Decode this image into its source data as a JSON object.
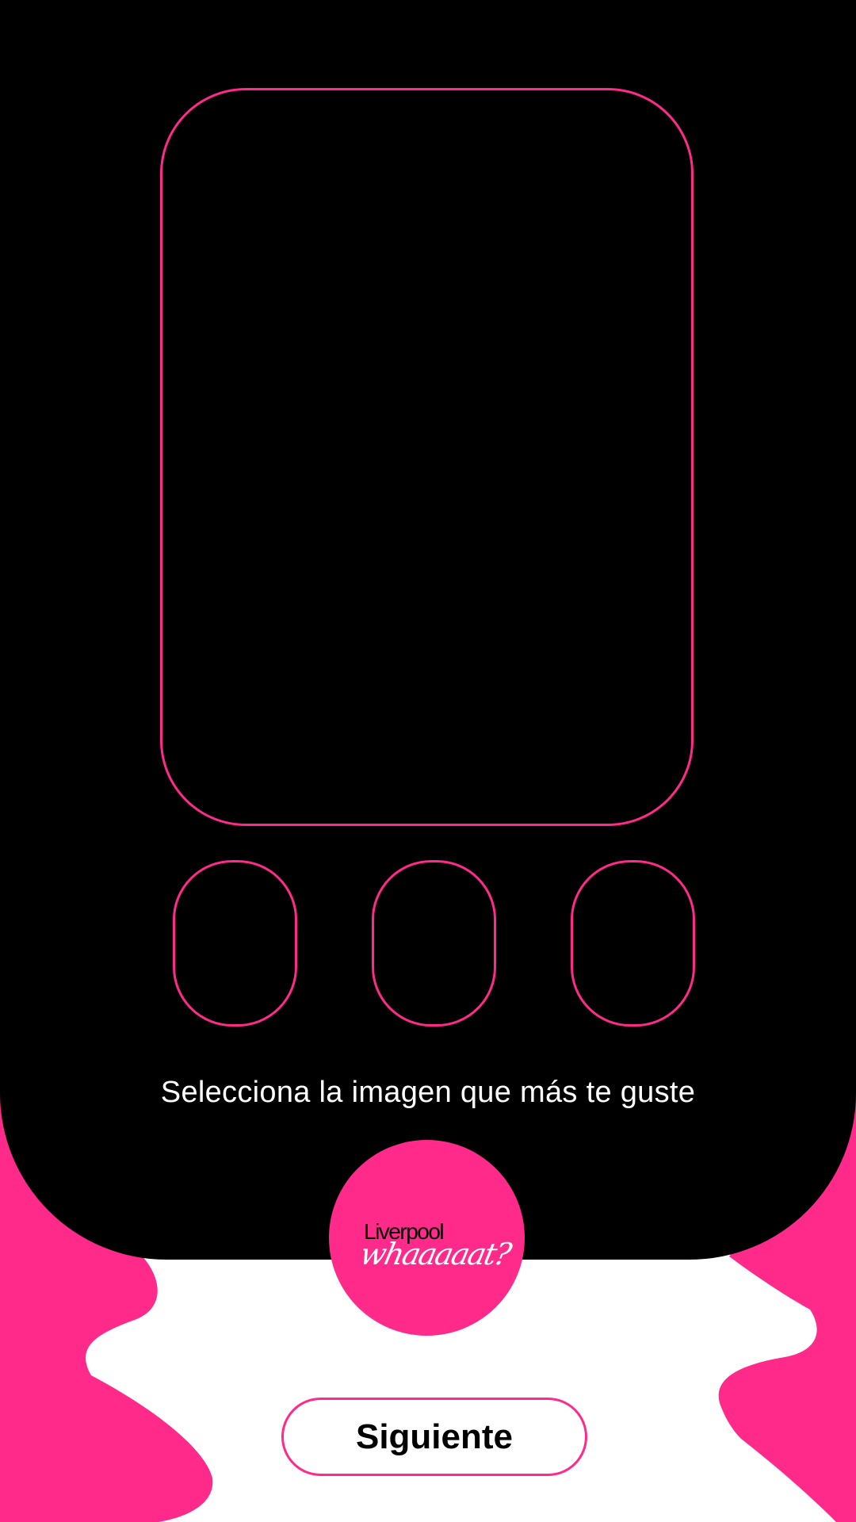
{
  "colors": {
    "accent": "#ff2a8a",
    "panel": "#000000",
    "background": "#ffffff",
    "text_light": "#ffffff",
    "text_dark": "#000000"
  },
  "gallery": {
    "thumbnails_count": 3
  },
  "instruction": "Selecciona la imagen que más te guste",
  "logo": {
    "brand": "Liverpool",
    "script": "whaaaaat?"
  },
  "next_button": {
    "label": "Siguiente"
  }
}
